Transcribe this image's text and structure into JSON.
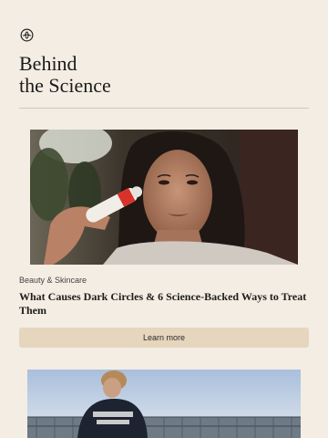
{
  "header": {
    "logo_icon": "lotus-circle-icon",
    "title_line1": "Behind",
    "title_line2": "the Science"
  },
  "article": {
    "category": "Beauty & Skincare",
    "headline": "What Causes Dark Circles & 6 Science-Backed Ways to Treat Them",
    "cta_label": "Learn more"
  },
  "colors": {
    "background": "#f3ede3",
    "cta_background": "#e6d6bd",
    "divider": "#cfc6b8"
  }
}
